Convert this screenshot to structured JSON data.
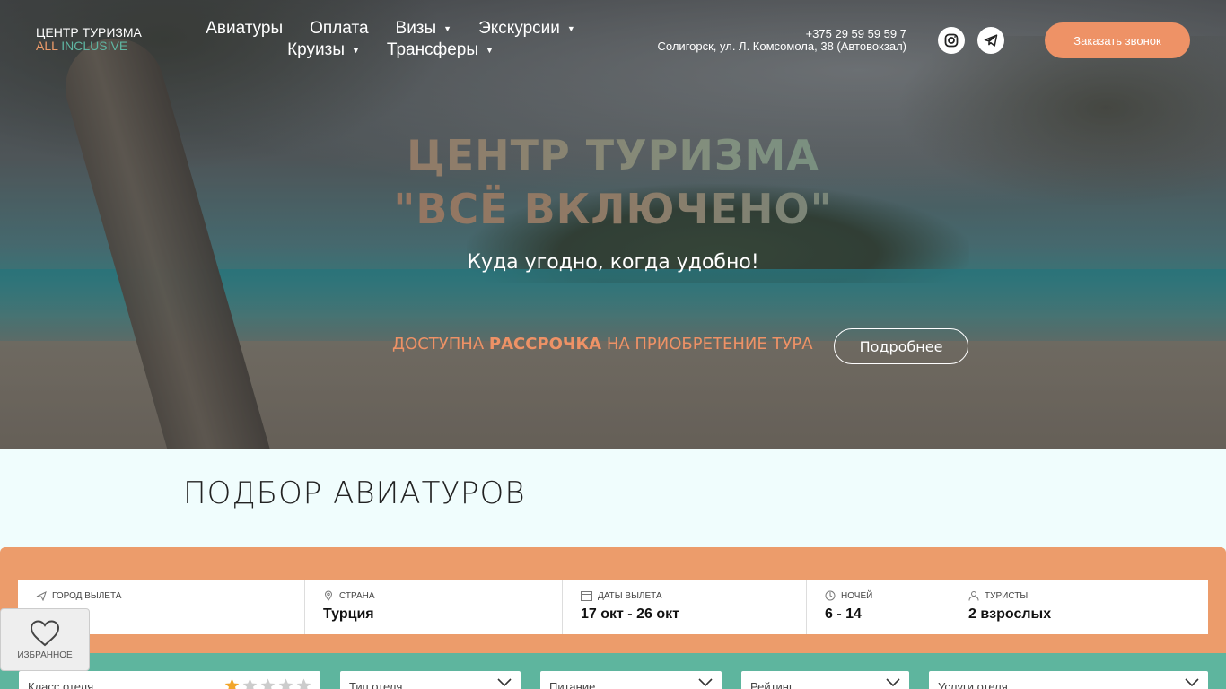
{
  "header": {
    "logo_line1": "ЦЕНТР ТУРИЗМА",
    "logo_all": "ALL",
    "logo_inclusive": "INCLUSIVE",
    "nav": {
      "aviatury": "Авиатуры",
      "oplata": "Оплата",
      "vizy": "Визы",
      "ekskursii": "Экскурсии",
      "kruizy": "Круизы",
      "transfery": "Трансферы"
    },
    "phone": "+375 29 59 59 59 7",
    "address": "Солигорск, ул. Л. Комсомола, 38 (Автовокзал)",
    "call_button": "Заказать звонок",
    "social_icons": [
      "instagram-icon",
      "telegram-icon"
    ]
  },
  "hero": {
    "title_line1": "ЦЕНТР ТУРИЗМА",
    "title_line2": "\"ВСЁ ВКЛЮЧЕНО\"",
    "subtitle": "Куда угодно, когда удобно!",
    "installment_pre": "ДОСТУПНА ",
    "installment_bold": "РАССРОЧКА",
    "installment_post": " НА ПРИОБРЕТЕНИЕ ТУРА",
    "more_button": "Подробнее"
  },
  "search": {
    "section_title": "ПОДБОР АВИАТУРОВ",
    "fields": {
      "city_label": "ГОРОД ВЫЛЕТА",
      "city_value": "",
      "country_label": "СТРАНА",
      "country_value": "Турция",
      "dates_label": "ДАТЫ ВЫЛЕТА",
      "dates_value": "17 окт - 26 окт",
      "nights_label": "НОЧЕЙ",
      "nights_value": "6 - 14",
      "tourists_label": "ТУРИСТЫ",
      "tourists_value": "2 взрослых"
    },
    "filters": {
      "hotel_class": "Класс отеля",
      "hotel_class_stars": 1,
      "hotel_type": "Тип отеля",
      "meal": "Питание",
      "rating": "Рейтинг",
      "services": "Услуги отеля"
    }
  },
  "favorites": {
    "label": "ИЗБРАННОЕ"
  },
  "colors": {
    "accent_orange": "#ee9266",
    "accent_green": "#5eb59e"
  }
}
